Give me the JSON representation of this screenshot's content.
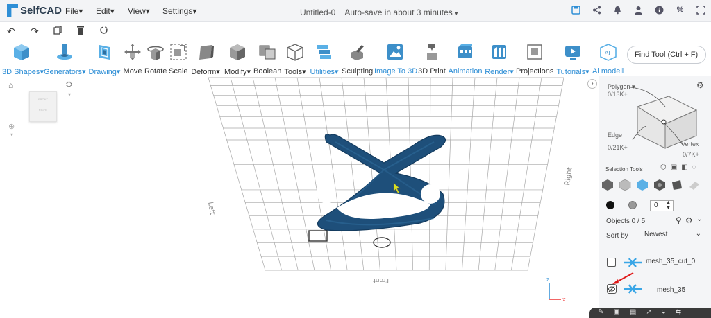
{
  "app": {
    "name": "SelfCAD"
  },
  "menu": {
    "file": "File",
    "edit": "Edit",
    "view": "View",
    "settings": "Settings"
  },
  "document": {
    "title": "Untitled-0",
    "autosave": "Auto-save in about 3 minutes"
  },
  "toolbar": {
    "items": [
      {
        "label": "3D Shapes",
        "icon": "cube-icon",
        "accent": true,
        "dropdown": true
      },
      {
        "label": "Generators",
        "icon": "generators-icon",
        "accent": true,
        "dropdown": true
      },
      {
        "label": "Drawing",
        "icon": "drawing-icon",
        "accent": true,
        "dropdown": true
      },
      {
        "label": "Move",
        "icon": "move-icon"
      },
      {
        "label": "Rotate",
        "icon": "rotate-icon"
      },
      {
        "label": "Scale",
        "icon": "scale-icon"
      },
      {
        "label": "Deform",
        "icon": "deform-icon",
        "dropdown": true
      },
      {
        "label": "Modify",
        "icon": "modify-icon",
        "dropdown": true
      },
      {
        "label": "Boolean",
        "icon": "boolean-icon"
      },
      {
        "label": "Tools",
        "icon": "tools-icon",
        "dropdown": true
      },
      {
        "label": "Utilities",
        "icon": "utilities-icon",
        "accent": true,
        "dropdown": true
      },
      {
        "label": "Sculpting",
        "icon": "sculpting-icon"
      },
      {
        "label": "Image To 3D",
        "icon": "image-to-3d-icon",
        "accent": true
      },
      {
        "label": "3D Print",
        "icon": "3d-print-icon"
      },
      {
        "label": "Animation",
        "icon": "animation-icon",
        "accent": true
      },
      {
        "label": "Render",
        "icon": "render-icon",
        "accent": true,
        "dropdown": true
      },
      {
        "label": "Projections",
        "icon": "projections-icon"
      },
      {
        "label": "Tutorials",
        "icon": "tutorials-icon",
        "accent": true,
        "dropdown": true
      },
      {
        "label": "Ai modeling",
        "icon": "ai-modeling-icon",
        "accent": true
      }
    ],
    "find_placeholder": "Find Tool (Ctrl + F)"
  },
  "viewport": {
    "labels": {
      "front": "Front",
      "right": "Right",
      "left": "Left"
    }
  },
  "panel": {
    "polygon_label": "Polygon",
    "polygon_count": "0/13K+",
    "edge_label": "Edge",
    "edge_count": "0/21K+",
    "vertex_label": "Vertex",
    "vertex_count": "0/7K+",
    "selection_tools": "Selection Tools",
    "stepper_value": "0",
    "objects_label": "Objects 0 / 5",
    "sort_by": "Sort by",
    "sort_value": "Newest",
    "objects": [
      {
        "name": "mesh_35_cut_0"
      },
      {
        "name": "mesh_35"
      }
    ]
  },
  "colors": {
    "accent": "#2f8fd6",
    "mesh": "#1e4f7a",
    "grid": "#9a9a9a"
  }
}
